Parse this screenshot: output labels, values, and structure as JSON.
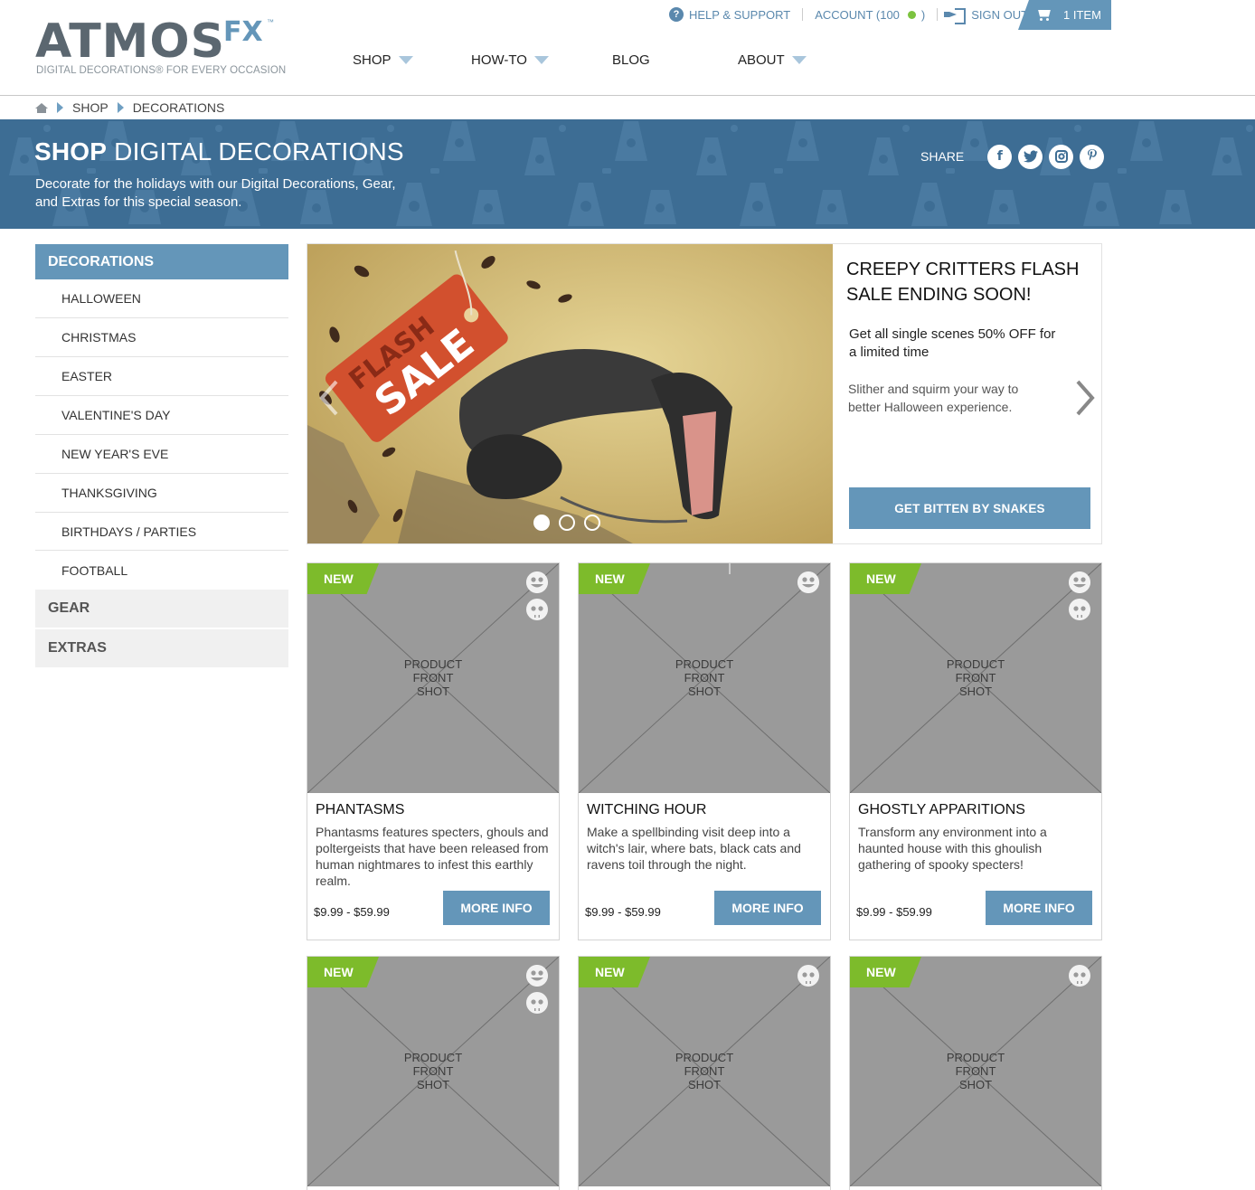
{
  "brand": {
    "name": "ATMOS",
    "suffix": "FX",
    "tm": "™",
    "tagline": "DIGITAL DECORATIONS® FOR EVERY OCCASION",
    "accent_color": "#6496b9",
    "text_color": "#5b6770"
  },
  "utility_nav": {
    "help": "HELP & SUPPORT",
    "account": "ACCOUNT (100",
    "signout": "SIGN OUT",
    "cart": "1 ITEM"
  },
  "main_nav": [
    {
      "label": "SHOP",
      "has_dropdown": true
    },
    {
      "label": "HOW-TO",
      "has_dropdown": true
    },
    {
      "label": "BLOG",
      "has_dropdown": false
    },
    {
      "label": "ABOUT",
      "has_dropdown": true
    }
  ],
  "breadcrumb": [
    "SHOP",
    "DECORATIONS"
  ],
  "hero": {
    "title_bold": "SHOP",
    "title_rest": "DIGITAL DECORATIONS",
    "subtitle": "Decorate for the holidays with our Digital Decorations, Gear, and Extras for this special season.",
    "share_label": "SHARE",
    "social": [
      "facebook-icon",
      "twitter-icon",
      "instagram-icon",
      "pinterest-icon"
    ],
    "bg_color": "#3d6d94"
  },
  "sidebar": {
    "header": "DECORATIONS",
    "items": [
      "HALLOWEEN",
      "CHRISTMAS",
      "EASTER",
      "VALENTINE'S DAY",
      "NEW YEAR'S EVE",
      "THANKSGIVING",
      "BIRTHDAYS / PARTIES",
      "FOOTBALL"
    ],
    "categories": [
      "GEAR",
      "EXTRAS"
    ]
  },
  "carousel": {
    "image_text": "FLASH SALE",
    "title": "CREEPY CRITTERS FLASH SALE ENDING SOON!",
    "lead": "Get all single scenes 50% OFF for a limited time",
    "description": "Slither and squirm your way to better Halloween experience.",
    "cta": "GET BITTEN BY SNAKES",
    "dots": 3,
    "active_dot": 0
  },
  "products": [
    {
      "badge": "NEW",
      "placeholder": [
        "PRODUCT",
        "FRONT",
        "SHOT"
      ],
      "icons": [
        "smiley-icon",
        "skull-icon"
      ],
      "title": "PHANTASMS",
      "description": "Phantasms features specters, ghouls and poltergeists that have been released from human nightmares to infest this earthly realm.",
      "price": "$9.99  - $59.99",
      "button": "MORE INFO"
    },
    {
      "badge": "NEW",
      "placeholder": [
        "PRODUCT",
        "FRONT",
        "SHOT"
      ],
      "icons": [
        "smiley-icon"
      ],
      "title": "WITCHING HOUR",
      "description": "Make a spellbinding visit deep into a witch's lair, where bats, black cats and ravens toil through the night.",
      "price": "$9.99  - $59.99",
      "button": "MORE INFO"
    },
    {
      "badge": "NEW",
      "placeholder": [
        "PRODUCT",
        "FRONT",
        "SHOT"
      ],
      "icons": [
        "smiley-icon",
        "skull-icon"
      ],
      "title": "GHOSTLY APPARITIONS",
      "description": "Transform any environment into a haunted house with this ghoulish gathering of spooky specters!",
      "price": "$9.99  - $59.99",
      "button": "MORE INFO"
    },
    {
      "badge": "NEW",
      "placeholder": [
        "PRODUCT",
        "FRONT",
        "SHOT"
      ],
      "icons": [
        "smiley-icon",
        "skull-icon"
      ]
    },
    {
      "badge": "NEW",
      "placeholder": [
        "PRODUCT",
        "FRONT",
        "SHOT"
      ],
      "icons": [
        "skull-icon"
      ]
    },
    {
      "badge": "NEW",
      "placeholder": [
        "PRODUCT",
        "FRONT",
        "SHOT"
      ],
      "icons": [
        "skull-icon"
      ]
    }
  ]
}
